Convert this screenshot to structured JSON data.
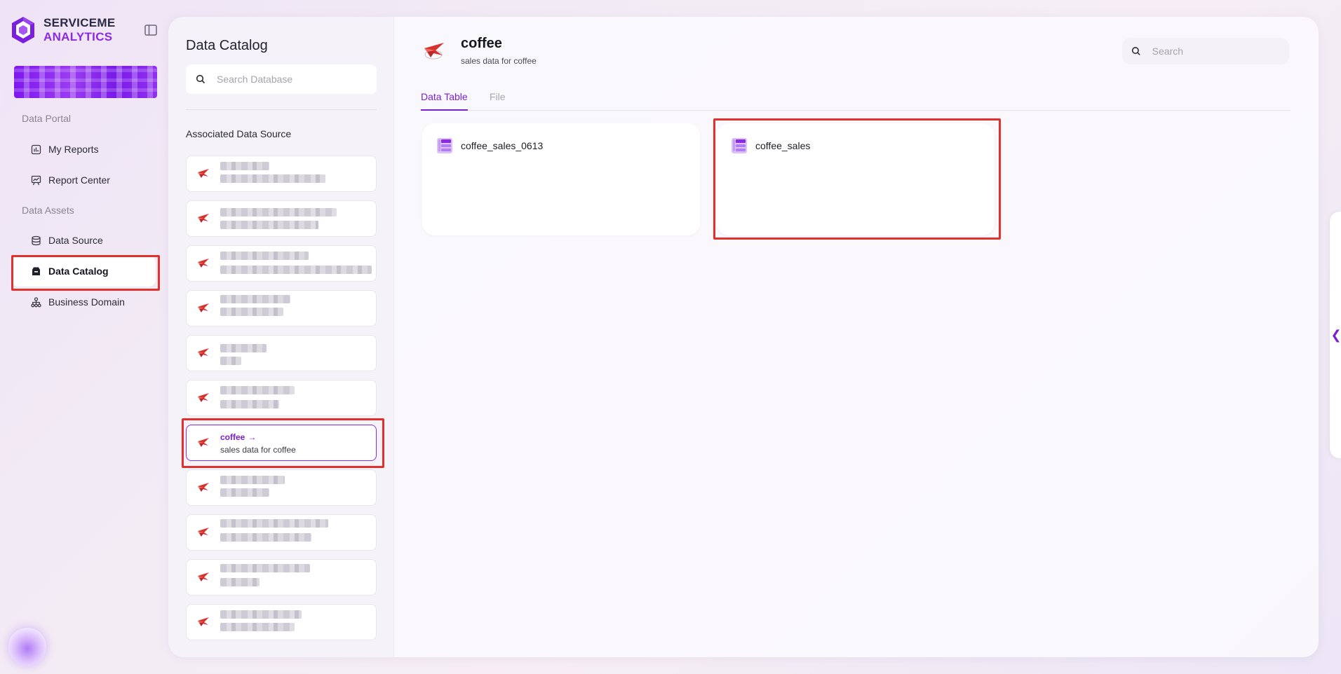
{
  "brand": {
    "line1": "SERVICEME",
    "line2": "ANALYTICS"
  },
  "nav": {
    "section_portal": "Data Portal",
    "my_reports": "My Reports",
    "report_center": "Report Center",
    "section_assets": "Data Assets",
    "data_source": "Data Source",
    "data_catalog": "Data Catalog",
    "business_domain": "Business Domain"
  },
  "catalog": {
    "title": "Data Catalog",
    "search_placeholder": "Search Database",
    "associated_label": "Associated Data Source",
    "active_source": {
      "name": "coffee",
      "arrow": "→",
      "description": "sales data for coffee"
    }
  },
  "detail": {
    "title": "coffee",
    "subtitle": "sales data for coffee",
    "search_placeholder": "Search",
    "tabs": [
      "Data Table",
      "File"
    ],
    "active_tab": "Data Table",
    "tables": [
      "coffee_sales_0613",
      "coffee_sales"
    ]
  },
  "colors": {
    "accent": "#7b1fd6",
    "highlight": "#e0312c",
    "brand_purple": "#8a2be2"
  },
  "handle": {
    "glyph": "❮"
  }
}
